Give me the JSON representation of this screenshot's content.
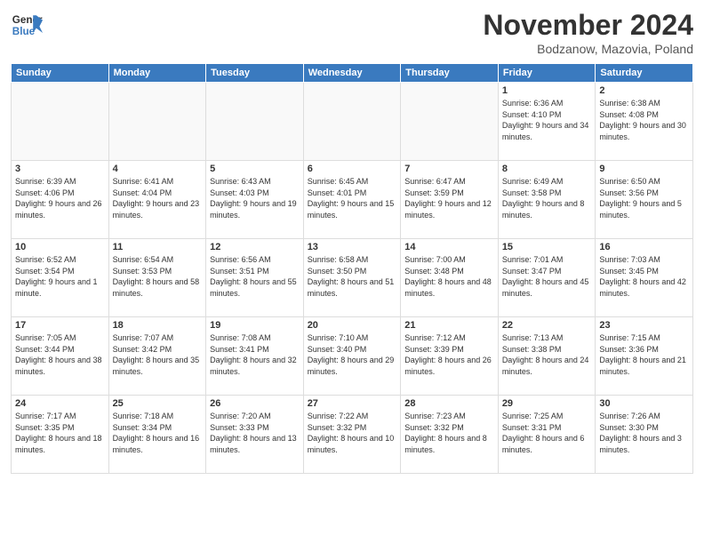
{
  "logo": {
    "text_general": "General",
    "text_blue": "Blue"
  },
  "title": "November 2024",
  "location": "Bodzanow, Mazovia, Poland",
  "days_of_week": [
    "Sunday",
    "Monday",
    "Tuesday",
    "Wednesday",
    "Thursday",
    "Friday",
    "Saturday"
  ],
  "weeks": [
    [
      {
        "day": "",
        "empty": true
      },
      {
        "day": "",
        "empty": true
      },
      {
        "day": "",
        "empty": true
      },
      {
        "day": "",
        "empty": true
      },
      {
        "day": "",
        "empty": true
      },
      {
        "day": "1",
        "sunrise": "6:36 AM",
        "sunset": "4:10 PM",
        "daylight": "9 hours and 34 minutes."
      },
      {
        "day": "2",
        "sunrise": "6:38 AM",
        "sunset": "4:08 PM",
        "daylight": "9 hours and 30 minutes."
      }
    ],
    [
      {
        "day": "3",
        "sunrise": "6:39 AM",
        "sunset": "4:06 PM",
        "daylight": "9 hours and 26 minutes."
      },
      {
        "day": "4",
        "sunrise": "6:41 AM",
        "sunset": "4:04 PM",
        "daylight": "9 hours and 23 minutes."
      },
      {
        "day": "5",
        "sunrise": "6:43 AM",
        "sunset": "4:03 PM",
        "daylight": "9 hours and 19 minutes."
      },
      {
        "day": "6",
        "sunrise": "6:45 AM",
        "sunset": "4:01 PM",
        "daylight": "9 hours and 15 minutes."
      },
      {
        "day": "7",
        "sunrise": "6:47 AM",
        "sunset": "3:59 PM",
        "daylight": "9 hours and 12 minutes."
      },
      {
        "day": "8",
        "sunrise": "6:49 AM",
        "sunset": "3:58 PM",
        "daylight": "9 hours and 8 minutes."
      },
      {
        "day": "9",
        "sunrise": "6:50 AM",
        "sunset": "3:56 PM",
        "daylight": "9 hours and 5 minutes."
      }
    ],
    [
      {
        "day": "10",
        "sunrise": "6:52 AM",
        "sunset": "3:54 PM",
        "daylight": "9 hours and 1 minute."
      },
      {
        "day": "11",
        "sunrise": "6:54 AM",
        "sunset": "3:53 PM",
        "daylight": "8 hours and 58 minutes."
      },
      {
        "day": "12",
        "sunrise": "6:56 AM",
        "sunset": "3:51 PM",
        "daylight": "8 hours and 55 minutes."
      },
      {
        "day": "13",
        "sunrise": "6:58 AM",
        "sunset": "3:50 PM",
        "daylight": "8 hours and 51 minutes."
      },
      {
        "day": "14",
        "sunrise": "7:00 AM",
        "sunset": "3:48 PM",
        "daylight": "8 hours and 48 minutes."
      },
      {
        "day": "15",
        "sunrise": "7:01 AM",
        "sunset": "3:47 PM",
        "daylight": "8 hours and 45 minutes."
      },
      {
        "day": "16",
        "sunrise": "7:03 AM",
        "sunset": "3:45 PM",
        "daylight": "8 hours and 42 minutes."
      }
    ],
    [
      {
        "day": "17",
        "sunrise": "7:05 AM",
        "sunset": "3:44 PM",
        "daylight": "8 hours and 38 minutes."
      },
      {
        "day": "18",
        "sunrise": "7:07 AM",
        "sunset": "3:42 PM",
        "daylight": "8 hours and 35 minutes."
      },
      {
        "day": "19",
        "sunrise": "7:08 AM",
        "sunset": "3:41 PM",
        "daylight": "8 hours and 32 minutes."
      },
      {
        "day": "20",
        "sunrise": "7:10 AM",
        "sunset": "3:40 PM",
        "daylight": "8 hours and 29 minutes."
      },
      {
        "day": "21",
        "sunrise": "7:12 AM",
        "sunset": "3:39 PM",
        "daylight": "8 hours and 26 minutes."
      },
      {
        "day": "22",
        "sunrise": "7:13 AM",
        "sunset": "3:38 PM",
        "daylight": "8 hours and 24 minutes."
      },
      {
        "day": "23",
        "sunrise": "7:15 AM",
        "sunset": "3:36 PM",
        "daylight": "8 hours and 21 minutes."
      }
    ],
    [
      {
        "day": "24",
        "sunrise": "7:17 AM",
        "sunset": "3:35 PM",
        "daylight": "8 hours and 18 minutes."
      },
      {
        "day": "25",
        "sunrise": "7:18 AM",
        "sunset": "3:34 PM",
        "daylight": "8 hours and 16 minutes."
      },
      {
        "day": "26",
        "sunrise": "7:20 AM",
        "sunset": "3:33 PM",
        "daylight": "8 hours and 13 minutes."
      },
      {
        "day": "27",
        "sunrise": "7:22 AM",
        "sunset": "3:32 PM",
        "daylight": "8 hours and 10 minutes."
      },
      {
        "day": "28",
        "sunrise": "7:23 AM",
        "sunset": "3:32 PM",
        "daylight": "8 hours and 8 minutes."
      },
      {
        "day": "29",
        "sunrise": "7:25 AM",
        "sunset": "3:31 PM",
        "daylight": "8 hours and 6 minutes."
      },
      {
        "day": "30",
        "sunrise": "7:26 AM",
        "sunset": "3:30 PM",
        "daylight": "8 hours and 3 minutes."
      }
    ]
  ]
}
